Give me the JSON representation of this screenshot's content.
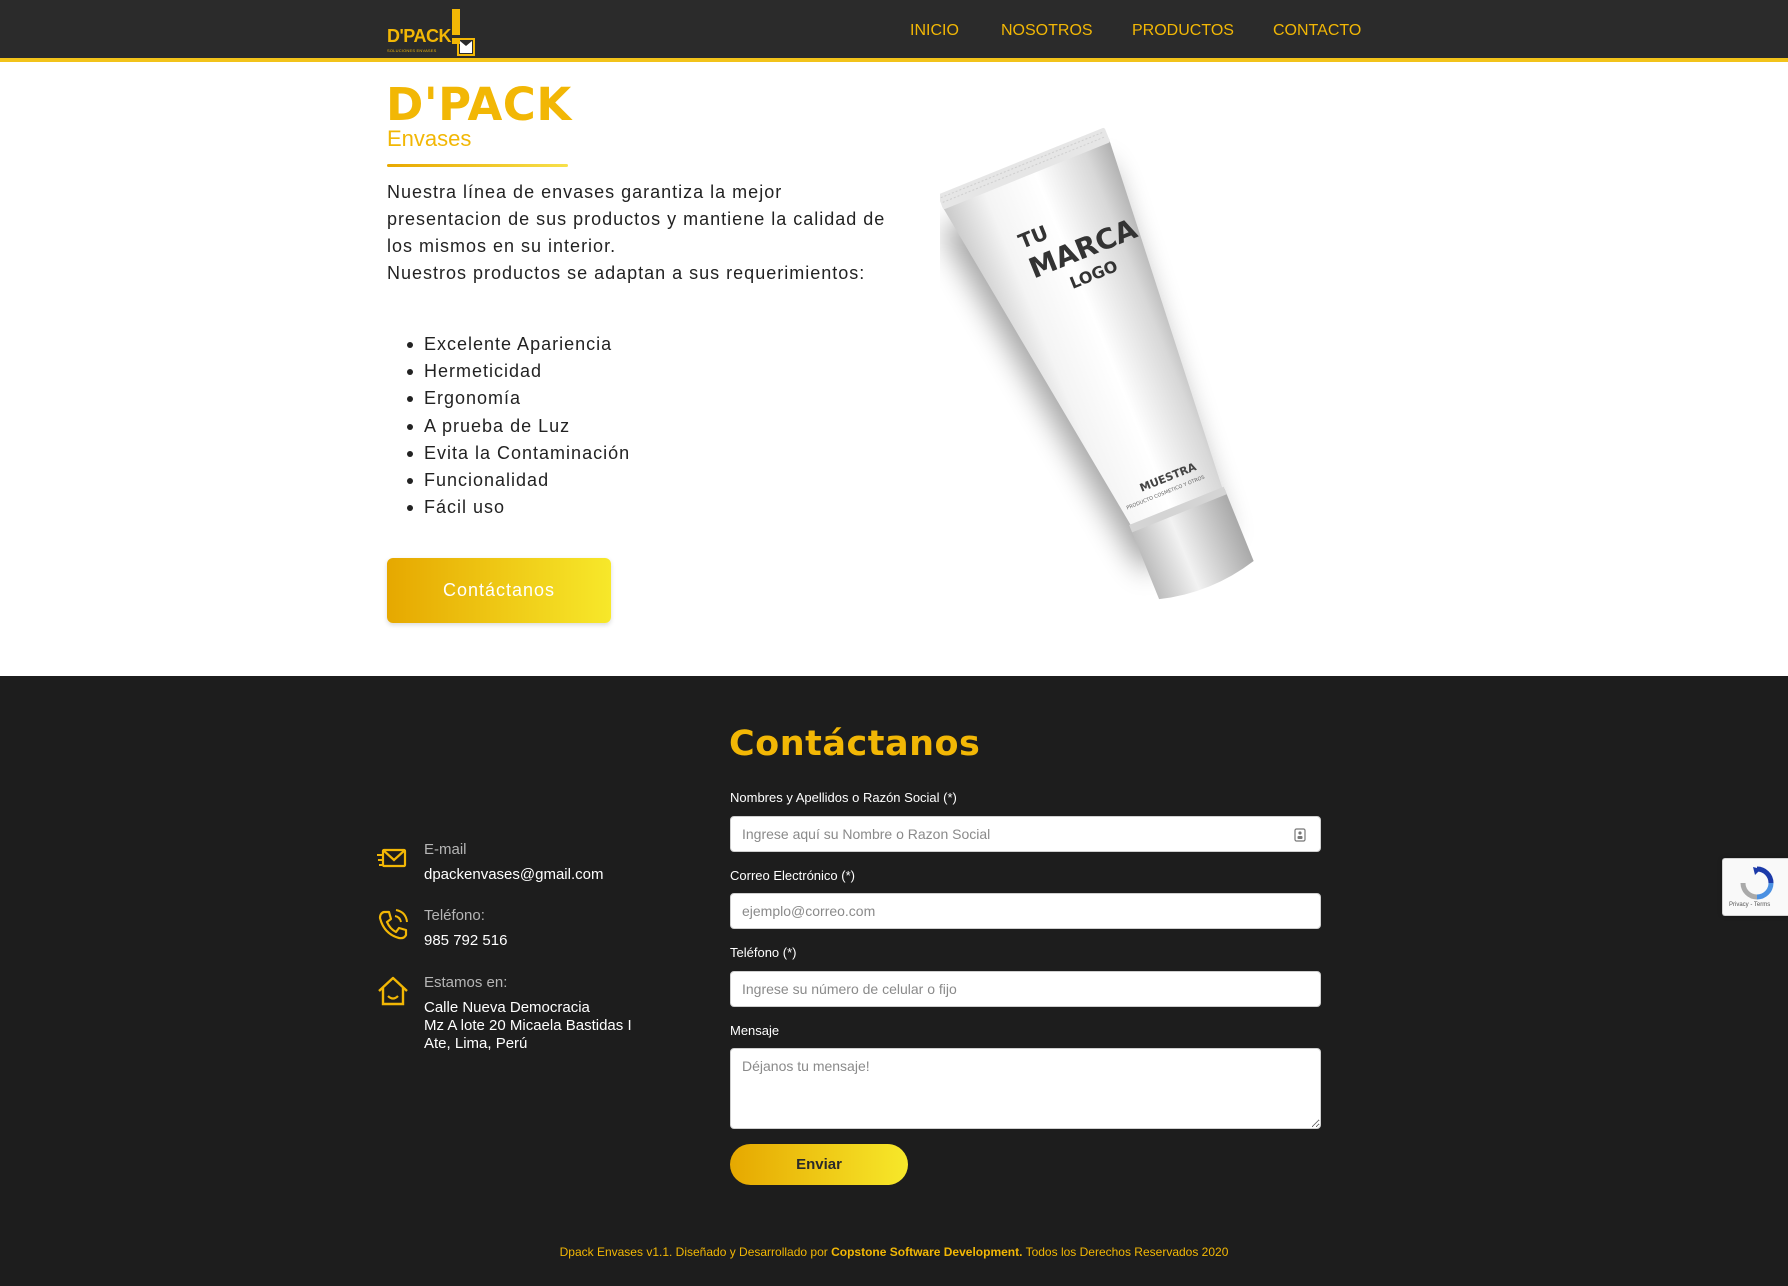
{
  "brand": {
    "logo_text": "D'PACK",
    "logo_tagline": "SOLUCIONES ENVASES"
  },
  "nav": {
    "items": [
      {
        "label": "INICIO"
      },
      {
        "label": "NOSOTROS"
      },
      {
        "label": "PRODUCTOS"
      },
      {
        "label": "CONTACTO"
      }
    ]
  },
  "hero": {
    "title": "D'PACK",
    "subtitle": "Envases",
    "paragraph_1": "Nuestra línea de envases garantiza la mejor presentacion de sus productos y mantiene la calidad de los mismos en su interior.",
    "paragraph_2": "Nuestros productos se adaptan a sus requerimientos:",
    "features": [
      "Excelente Apariencia",
      "Hermeticidad",
      "Ergonomía",
      "A prueba de Luz",
      "Evita la Contaminación",
      "Funcionalidad",
      "Fácil uso"
    ],
    "cta_label": "Contáctanos",
    "product_image": {
      "label_line_1": "TU",
      "label_line_2": "MARCA",
      "label_line_3": "LOGO",
      "sample_text": "MUESTRA",
      "sample_subtext": "PRODUCTO COSMETICO Y OTROS"
    }
  },
  "contact": {
    "title": "Contáctanos",
    "info": {
      "email_label": "E-mail",
      "email_value": "dpackenvases@gmail.com",
      "phone_label": "Teléfono:",
      "phone_value": "985 792 516",
      "address_label": "Estamos en:",
      "address_line_1": "Calle Nueva Democracia",
      "address_line_2": "Mz A lote 20 Micaela Bastidas I",
      "address_line_3": "Ate, Lima, Perú"
    },
    "form": {
      "name_label": "Nombres y Apellidos o Razón Social (*)",
      "name_placeholder": "Ingrese aquí su Nombre o Razon Social",
      "name_value": "",
      "email_label": "Correo Electrónico (*)",
      "email_placeholder": "ejemplo@correo.com",
      "email_value": "",
      "phone_label": "Teléfono (*)",
      "phone_placeholder": "Ingrese su número de celular o fijo",
      "phone_value": "",
      "message_label": "Mensaje",
      "message_placeholder": "Déjanos tu mensaje!",
      "message_value": "",
      "submit_label": "Enviar"
    }
  },
  "footer": {
    "text_before": "Dpack Envases v1.1. Diseñado y Desarrollado por ",
    "company": "Copstone Software Development.",
    "text_after": " Todos los Derechos Reservados 2020"
  },
  "recaptcha": {
    "text": "Privacy - Terms"
  },
  "colors": {
    "accent": "#f2b705",
    "accent_light": "#f7e82a",
    "nav_bg": "#2b2b2b",
    "footer_bg": "#1d1d1d"
  },
  "icons": {
    "email": "mail-icon",
    "phone": "phone-icon",
    "address": "home-icon",
    "recaptcha": "recaptcha-icon",
    "autofill": "autofill-icon"
  }
}
